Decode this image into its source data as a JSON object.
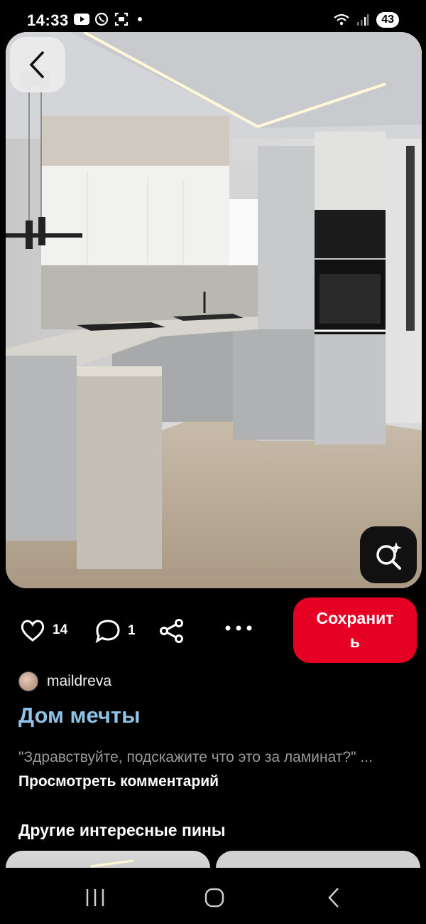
{
  "status_bar": {
    "time": "14:33",
    "battery": "43",
    "icons": [
      "youtube-icon",
      "viber-icon",
      "screenshot-icon",
      "wifi-icon",
      "signal-icon"
    ]
  },
  "pin": {
    "image_alt": "kitchen-photo",
    "likes": "14",
    "comments": "1",
    "save_label": "Сохранит\nь",
    "author": "maildreva",
    "title": "Дом мечты",
    "comment_text": "\"Здравствуйте, подскажите что это за ламинат?\" ...",
    "comment_more": "Просмотреть комментарий"
  },
  "more_pins": {
    "title": "Другие интересные пины"
  },
  "colors": {
    "save": "#e60023",
    "title": "#8fc3e6",
    "background": "#000000"
  }
}
